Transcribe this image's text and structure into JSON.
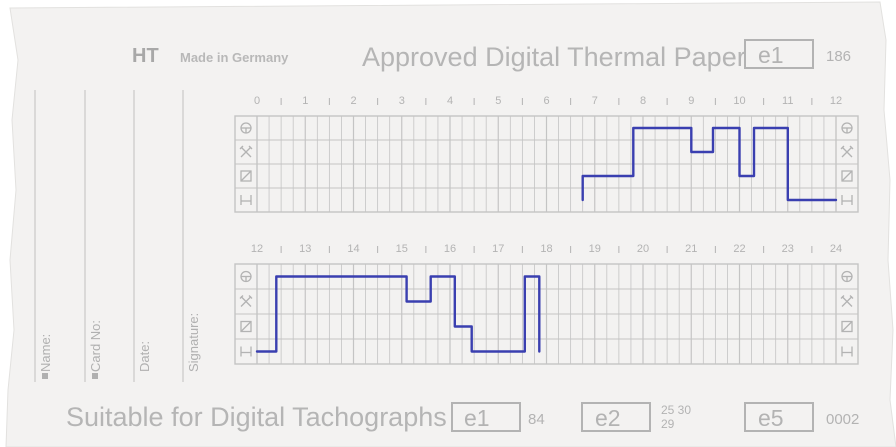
{
  "header": {
    "brand": "HT",
    "made_in": "Made in Germany",
    "title": "Approved Digital Thermal Paper",
    "approval_mark": "e1",
    "approval_number": "186"
  },
  "side_fields": {
    "name": "Name:",
    "card_no": "Card No:",
    "date": "Date:",
    "signature": "Signature:"
  },
  "upper_chart": {
    "hour_labels": [
      "0",
      "1",
      "2",
      "3",
      "4",
      "5",
      "6",
      "7",
      "8",
      "9",
      "10",
      "11",
      "12"
    ]
  },
  "lower_chart": {
    "hour_labels": [
      "12",
      "13",
      "14",
      "15",
      "16",
      "17",
      "18",
      "19",
      "20",
      "21",
      "22",
      "23",
      "24"
    ]
  },
  "footer": {
    "text": "Suitable for Digital Tachographs",
    "marks": [
      {
        "mark": "e1",
        "number": "84"
      },
      {
        "mark": "e2",
        "number_top": "25 30",
        "number_bottom": "29"
      },
      {
        "mark": "e5",
        "number": "0002"
      }
    ]
  },
  "activity_symbols": [
    "driving-wheel-icon",
    "work-hammers-icon",
    "availability-box-icon",
    "rest-bed-icon"
  ],
  "activity_trace": {
    "levels": [
      "driving",
      "work",
      "availability",
      "rest"
    ],
    "upper": [
      {
        "hour": 6.75,
        "level": "rest"
      },
      {
        "hour": 6.75,
        "level": "availability"
      },
      {
        "hour": 7.8,
        "level": "availability"
      },
      {
        "hour": 7.8,
        "level": "driving"
      },
      {
        "hour": 9.0,
        "level": "driving"
      },
      {
        "hour": 9.0,
        "level": "work"
      },
      {
        "hour": 9.45,
        "level": "work"
      },
      {
        "hour": 9.45,
        "level": "driving"
      },
      {
        "hour": 10.0,
        "level": "driving"
      },
      {
        "hour": 10.0,
        "level": "availability"
      },
      {
        "hour": 10.3,
        "level": "availability"
      },
      {
        "hour": 10.3,
        "level": "driving"
      },
      {
        "hour": 11.0,
        "level": "driving"
      },
      {
        "hour": 11.0,
        "level": "rest"
      },
      {
        "hour": 12.0,
        "level": "rest"
      }
    ],
    "lower": [
      {
        "hour": 12.0,
        "level": "rest"
      },
      {
        "hour": 12.4,
        "level": "rest"
      },
      {
        "hour": 12.4,
        "level": "driving"
      },
      {
        "hour": 15.1,
        "level": "driving"
      },
      {
        "hour": 15.1,
        "level": "work"
      },
      {
        "hour": 15.6,
        "level": "work"
      },
      {
        "hour": 15.6,
        "level": "driving"
      },
      {
        "hour": 16.1,
        "level": "driving"
      },
      {
        "hour": 16.1,
        "level": "availability"
      },
      {
        "hour": 16.45,
        "level": "availability"
      },
      {
        "hour": 16.45,
        "level": "rest"
      },
      {
        "hour": 17.55,
        "level": "rest"
      },
      {
        "hour": 17.55,
        "level": "driving"
      },
      {
        "hour": 17.85,
        "level": "driving"
      },
      {
        "hour": 17.85,
        "level": "rest"
      }
    ]
  },
  "colors": {
    "paper": "#f3f2f1",
    "print": "#b3b3b3",
    "grid": "#c4c4c4",
    "ink": "#3a3fb0"
  }
}
